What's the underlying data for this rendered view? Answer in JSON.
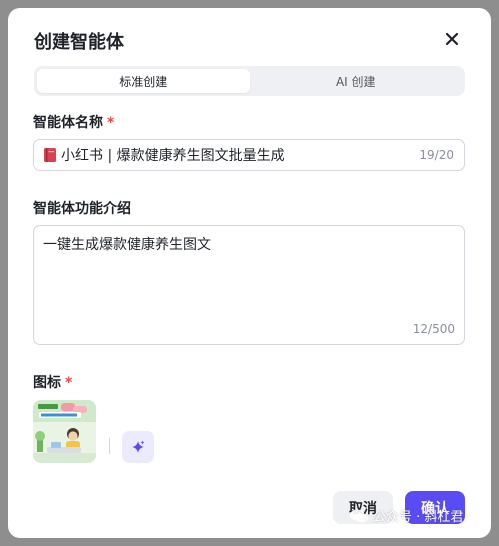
{
  "dialog": {
    "title": "创建智能体",
    "tabs": [
      {
        "label": "标准创建",
        "active": true
      },
      {
        "label": "AI 创建",
        "active": false
      }
    ]
  },
  "name_field": {
    "label": "智能体名称",
    "required_mark": "*",
    "value": "小红书 | 爆款健康养生图文批量生成",
    "count": "19/20",
    "prefix_icon": "red-book-icon"
  },
  "intro_field": {
    "label": "智能体功能介绍",
    "value": "一键生成爆款健康养生图文",
    "count": "12/500"
  },
  "icon_field": {
    "label": "图标",
    "required_mark": "*",
    "generate_icon": "sparkle-icon"
  },
  "actions": {
    "cancel_label": "取消",
    "confirm_label": "确认"
  },
  "watermark": {
    "text": "公众号 · 斜杠君"
  },
  "colors": {
    "accent": "#5a4cf5",
    "required": "#e5484d",
    "backdrop": "#8e8e8e"
  }
}
